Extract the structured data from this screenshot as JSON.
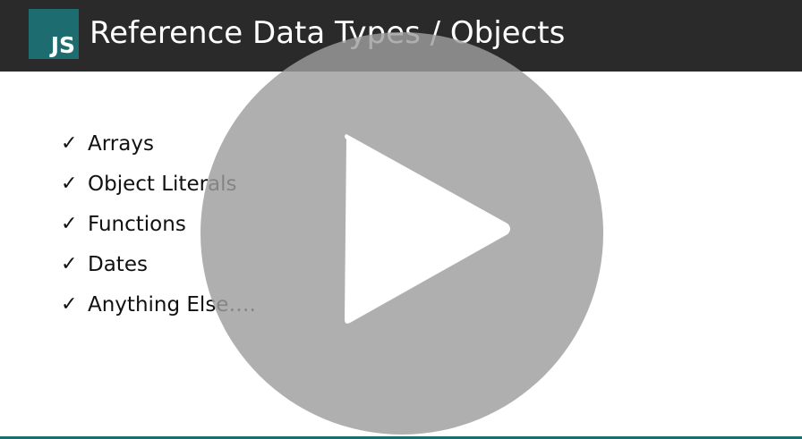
{
  "slide": {
    "logo_text": "JS",
    "title": "Reference Data Types / Objects",
    "check_glyph": "✓",
    "bullets": [
      {
        "label": "Arrays"
      },
      {
        "label": "Object Literals"
      },
      {
        "label": "Functions"
      },
      {
        "label": "Dates"
      },
      {
        "label": "Anything Else…."
      }
    ]
  },
  "player": {
    "play_icon": "play-icon"
  },
  "colors": {
    "header_bg": "#2a2a2a",
    "logo_bg": "#1d6c70",
    "overlay": "#9e9e9e"
  }
}
